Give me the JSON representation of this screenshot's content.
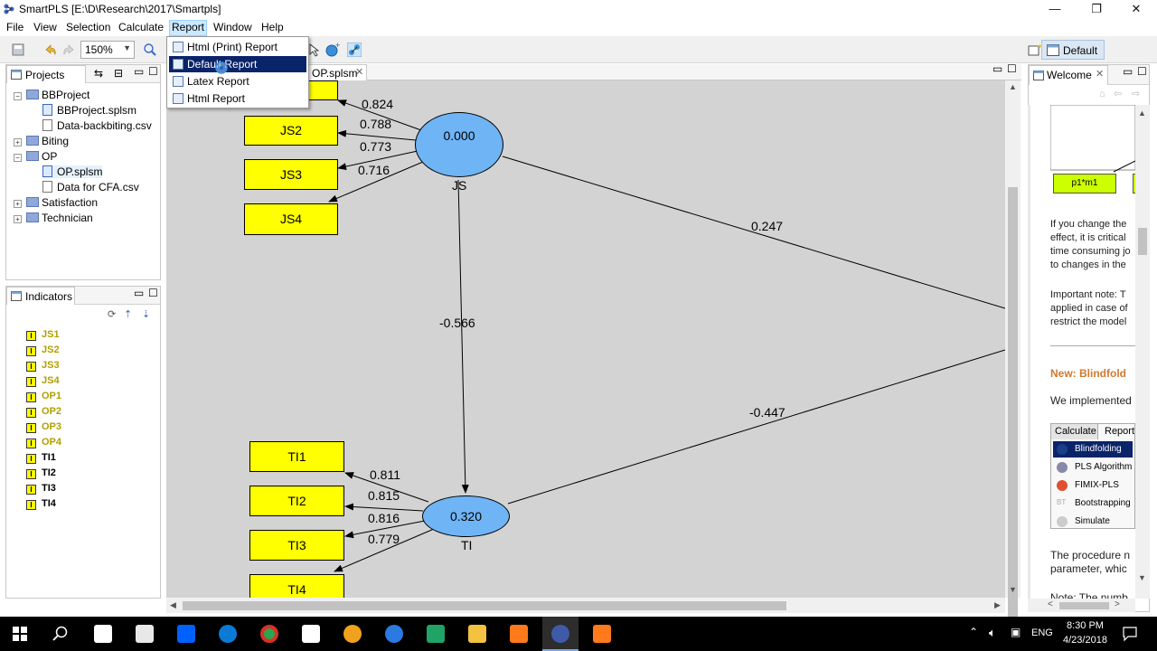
{
  "window": {
    "title": "SmartPLS [E:\\D\\Research\\2017\\Smartpls]",
    "minimize": "—",
    "restore": "❐",
    "close": "✕"
  },
  "menubar": [
    "File",
    "View",
    "Selection",
    "Calculate",
    "Report",
    "Window",
    "Help"
  ],
  "toolbar": {
    "zoom": "150%",
    "perspective": "Default"
  },
  "report_menu": [
    {
      "label": "Html (Print) Report",
      "selected": false
    },
    {
      "label": "Default Report",
      "selected": true
    },
    {
      "label": "Latex Report",
      "selected": false
    },
    {
      "label": "Html Report",
      "selected": false
    }
  ],
  "projects": {
    "tab": "Projects",
    "items": [
      {
        "label": "BBProject",
        "type": "folder",
        "level": 0,
        "toggle": "−"
      },
      {
        "label": "BBProject.splsm",
        "type": "model",
        "level": 1
      },
      {
        "label": "Data-backbiting.csv",
        "type": "file",
        "level": 1
      },
      {
        "label": "Biting",
        "type": "folder",
        "level": 0,
        "toggle": "+"
      },
      {
        "label": "OP",
        "type": "folder",
        "level": 0,
        "toggle": "−"
      },
      {
        "label": "OP.splsm",
        "type": "model",
        "level": 1,
        "selected": true
      },
      {
        "label": "Data for CFA.csv",
        "type": "file",
        "level": 1
      },
      {
        "label": "Satisfaction",
        "type": "folder",
        "level": 0,
        "toggle": "+"
      },
      {
        "label": "Technician",
        "type": "folder",
        "level": 0,
        "toggle": "+"
      }
    ]
  },
  "indicators": {
    "tab": "Indicators",
    "items": [
      {
        "label": "JS1",
        "used": false
      },
      {
        "label": "JS2",
        "used": false
      },
      {
        "label": "JS3",
        "used": false
      },
      {
        "label": "JS4",
        "used": false
      },
      {
        "label": "OP1",
        "used": false
      },
      {
        "label": "OP2",
        "used": false
      },
      {
        "label": "OP3",
        "used": false
      },
      {
        "label": "OP4",
        "used": false
      },
      {
        "label": "TI1",
        "used": true
      },
      {
        "label": "TI2",
        "used": true
      },
      {
        "label": "TI3",
        "used": true
      },
      {
        "label": "TI4",
        "used": true
      }
    ]
  },
  "editor": {
    "tab": "OP.splsm"
  },
  "model": {
    "JS": {
      "name": "JS",
      "r2": "0.000",
      "indicators": [
        "JS2",
        "JS3",
        "JS4"
      ],
      "loadings": [
        "0.824",
        "0.788",
        "0.773",
        "0.716"
      ]
    },
    "TI": {
      "name": "TI",
      "r2": "0.320",
      "indicators": [
        "TI1",
        "TI2",
        "TI3",
        "TI4"
      ],
      "loadings": [
        "0.811",
        "0.815",
        "0.816",
        "0.779"
      ]
    },
    "paths": {
      "js_ti": "-0.566",
      "js_op": "0.247",
      "op_ti": "-0.447"
    }
  },
  "welcome": {
    "tab": "Welcome",
    "node_label": "p1*m1",
    "para1": [
      "If you change the",
      "effect, it is critical",
      "time consuming jo",
      "to changes in the"
    ],
    "para2": [
      "Important note: T",
      "applied in case of",
      "restrict the model"
    ],
    "heading": "New: Blindfold",
    "para3": "We implemented",
    "widget_tabs": [
      "Calculate",
      "Report"
    ],
    "widget_items": [
      {
        "label": "Blindfolding",
        "selected": true
      },
      {
        "label": "PLS Algorithm",
        "selected": false
      },
      {
        "label": "FIMIX-PLS",
        "selected": false
      },
      {
        "label": "Bootstrapping",
        "selected": false,
        "prefix": "BT"
      },
      {
        "label": "Simulate",
        "selected": false
      }
    ],
    "para4": [
      "The procedure n",
      "parameter, whic"
    ],
    "para5": "Note: The numb"
  },
  "taskbar": {
    "time": "8:30 PM",
    "date": "4/23/2018",
    "lang": "ENG",
    "colors": {
      "accent": "#0a246a",
      "indicator": "#ffff00",
      "latent": "#6fb4f5"
    }
  }
}
